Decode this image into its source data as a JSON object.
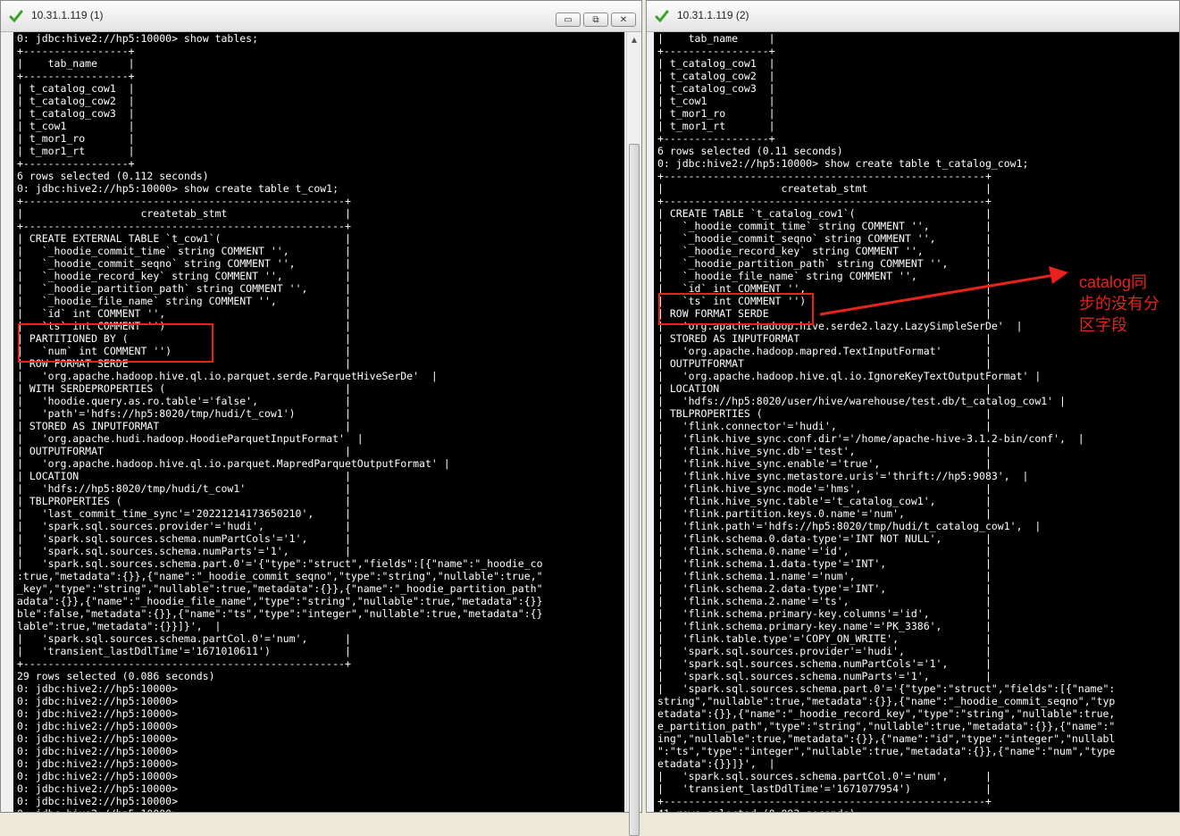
{
  "windows": [
    {
      "title": "10.31.1.119 (1)",
      "buttons": {
        "minimize": "▭",
        "maximize": "⧉",
        "close": "✕"
      },
      "lines": [
        "0: jdbc:hive2://hp5:10000> show tables;",
        "+-----------------+",
        "|    tab_name     |",
        "+-----------------+",
        "| t_catalog_cow1  |",
        "| t_catalog_cow2  |",
        "| t_catalog_cow3  |",
        "| t_cow1          |",
        "| t_mor1_ro       |",
        "| t_mor1_rt       |",
        "+-----------------+",
        "6 rows selected (0.112 seconds)",
        "0: jdbc:hive2://hp5:10000> show create table t_cow1;",
        "+----------------------------------------------------+",
        "|                   createtab_stmt                   |",
        "+----------------------------------------------------+",
        "| CREATE EXTERNAL TABLE `t_cow1`(                    |",
        "|   `_hoodie_commit_time` string COMMENT '',         |",
        "|   `_hoodie_commit_seqno` string COMMENT '',        |",
        "|   `_hoodie_record_key` string COMMENT '',          |",
        "|   `_hoodie_partition_path` string COMMENT '',      |",
        "|   `_hoodie_file_name` string COMMENT '',           |",
        "|   `id` int COMMENT '',                             |",
        "|   `ts` int COMMENT '')                             |",
        "| PARTITIONED BY (                                   |",
        "|   `num` int COMMENT '')                            |",
        "| ROW FORMAT SERDE                                   |",
        "|   'org.apache.hadoop.hive.ql.io.parquet.serde.ParquetHiveSerDe'  |",
        "| WITH SERDEPROPERTIES (                             |",
        "|   'hoodie.query.as.ro.table'='false',              |",
        "|   'path'='hdfs://hp5:8020/tmp/hudi/t_cow1')        |",
        "| STORED AS INPUTFORMAT                              |",
        "|   'org.apache.hudi.hadoop.HoodieParquetInputFormat'  |",
        "| OUTPUTFORMAT                                       |",
        "|   'org.apache.hadoop.hive.ql.io.parquet.MapredParquetOutputFormat' |",
        "| LOCATION                                           |",
        "|   'hdfs://hp5:8020/tmp/hudi/t_cow1'                |",
        "| TBLPROPERTIES (                                    |",
        "|   'last_commit_time_sync'='20221214173650210',     |",
        "|   'spark.sql.sources.provider'='hudi',             |",
        "|   'spark.sql.sources.schema.numPartCols'='1',      |",
        "|   'spark.sql.sources.schema.numParts'='1',         |",
        "|   'spark.sql.sources.schema.part.0'='{\"type\":\"struct\",\"fields\":[{\"name\":\"_hoodie_co",
        ":true,\"metadata\":{}},{\"name\":\"_hoodie_commit_seqno\",\"type\":\"string\",\"nullable\":true,\"",
        "_key\",\"type\":\"string\",\"nullable\":true,\"metadata\":{}},{\"name\":\"_hoodie_partition_path\"",
        "adata\":{}},{\"name\":\"_hoodie_file_name\",\"type\":\"string\",\"nullable\":true,\"metadata\":{}}",
        "ble\":false,\"metadata\":{}},{\"name\":\"ts\",\"type\":\"integer\",\"nullable\":true,\"metadata\":{}",
        "lable\":true,\"metadata\":{}}]}',  |",
        "|   'spark.sql.sources.schema.partCol.0'='num',      |",
        "|   'transient_lastDdlTime'='1671010611')            |",
        "+----------------------------------------------------+",
        "29 rows selected (0.086 seconds)",
        "0: jdbc:hive2://hp5:10000>",
        "0: jdbc:hive2://hp5:10000>",
        "0: jdbc:hive2://hp5:10000>",
        "0: jdbc:hive2://hp5:10000>",
        "0: jdbc:hive2://hp5:10000>",
        "0: jdbc:hive2://hp5:10000>",
        "0: jdbc:hive2://hp5:10000>",
        "0: jdbc:hive2://hp5:10000>",
        "0: jdbc:hive2://hp5:10000>",
        "0: jdbc:hive2://hp5:10000>",
        "0: jdbc:hive2://hp5:10000>"
      ]
    },
    {
      "title": "10.31.1.119 (2)",
      "lines": [
        "|    tab_name     |",
        "+-----------------+",
        "| t_catalog_cow1  |",
        "| t_catalog_cow2  |",
        "| t_catalog_cow3  |",
        "| t_cow1          |",
        "| t_mor1_ro       |",
        "| t_mor1_rt       |",
        "+-----------------+",
        "6 rows selected (0.11 seconds)",
        "0: jdbc:hive2://hp5:10000> show create table t_catalog_cow1;",
        "+----------------------------------------------------+",
        "|                   createtab_stmt                   |",
        "+----------------------------------------------------+",
        "| CREATE TABLE `t_catalog_cow1`(                     |",
        "|   `_hoodie_commit_time` string COMMENT '',         |",
        "|   `_hoodie_commit_seqno` string COMMENT '',        |",
        "|   `_hoodie_record_key` string COMMENT '',          |",
        "|   `_hoodie_partition_path` string COMMENT '',      |",
        "|   `_hoodie_file_name` string COMMENT '',           |",
        "|   `id` int COMMENT '',                             |",
        "|   `ts` int COMMENT '')                             |",
        "| ROW FORMAT SERDE                                   |",
        "|   'org.apache.hadoop.hive.serde2.lazy.LazySimpleSerDe'  |",
        "| STORED AS INPUTFORMAT                              |",
        "|   'org.apache.hadoop.mapred.TextInputFormat'       |",
        "| OUTPUTFORMAT                                       |",
        "|   'org.apache.hadoop.hive.ql.io.IgnoreKeyTextOutputFormat' |",
        "| LOCATION                                           |",
        "|   'hdfs://hp5:8020/user/hive/warehouse/test.db/t_catalog_cow1' |",
        "| TBLPROPERTIES (                                    |",
        "|   'flink.connector'='hudi',                        |",
        "|   'flink.hive_sync.conf.dir'='/home/apache-hive-3.1.2-bin/conf',  |",
        "|   'flink.hive_sync.db'='test',                     |",
        "|   'flink.hive_sync.enable'='true',                 |",
        "|   'flink.hive_sync.metastore.uris'='thrift://hp5:9083',  |",
        "|   'flink.hive_sync.mode'='hms',                    |",
        "|   'flink.hive_sync.table'='t_catalog_cow1',        |",
        "|   'flink.partition.keys.0.name'='num',             |",
        "|   'flink.path'='hdfs://hp5:8020/tmp/hudi/t_catalog_cow1',  |",
        "|   'flink.schema.0.data-type'='INT NOT NULL',       |",
        "|   'flink.schema.0.name'='id',                      |",
        "|   'flink.schema.1.data-type'='INT',                |",
        "|   'flink.schema.1.name'='num',                     |",
        "|   'flink.schema.2.data-type'='INT',                |",
        "|   'flink.schema.2.name'='ts',                      |",
        "|   'flink.schema.primary-key.columns'='id',         |",
        "|   'flink.schema.primary-key.name'='PK_3386',       |",
        "|   'flink.table.type'='COPY_ON_WRITE',              |",
        "|   'spark.sql.sources.provider'='hudi',             |",
        "|   'spark.sql.sources.schema.numPartCols'='1',      |",
        "|   'spark.sql.sources.schema.numParts'='1',         |",
        "|   'spark.sql.sources.schema.part.0'='{\"type\":\"struct\",\"fields\":[{\"name\":",
        "string\",\"nullable\":true,\"metadata\":{}},{\"name\":\"_hoodie_commit_seqno\",\"typ",
        "etadata\":{}},{\"name\":\"_hoodie_record_key\",\"type\":\"string\",\"nullable\":true,",
        "e_partition_path\",\"type\":\"string\",\"nullable\":true,\"metadata\":{}},{\"name\":\"",
        "ing\",\"nullable\":true,\"metadata\":{}},{\"name\":\"id\",\"type\":\"integer\",\"nullabl",
        "\":\"ts\",\"type\":\"integer\",\"nullable\":true,\"metadata\":{}},{\"name\":\"num\",\"type",
        "etadata\":{}}]}',  |",
        "|   'spark.sql.sources.schema.partCol.0'='num',      |",
        "|   'transient_lastDdlTime'='1671077954')            |",
        "+----------------------------------------------------+",
        "41 rows selected (0.093 seconds)"
      ]
    }
  ],
  "annotation": {
    "lines": [
      "catalog同",
      "步的没有分",
      "区字段"
    ],
    "color": "#e8221c"
  }
}
